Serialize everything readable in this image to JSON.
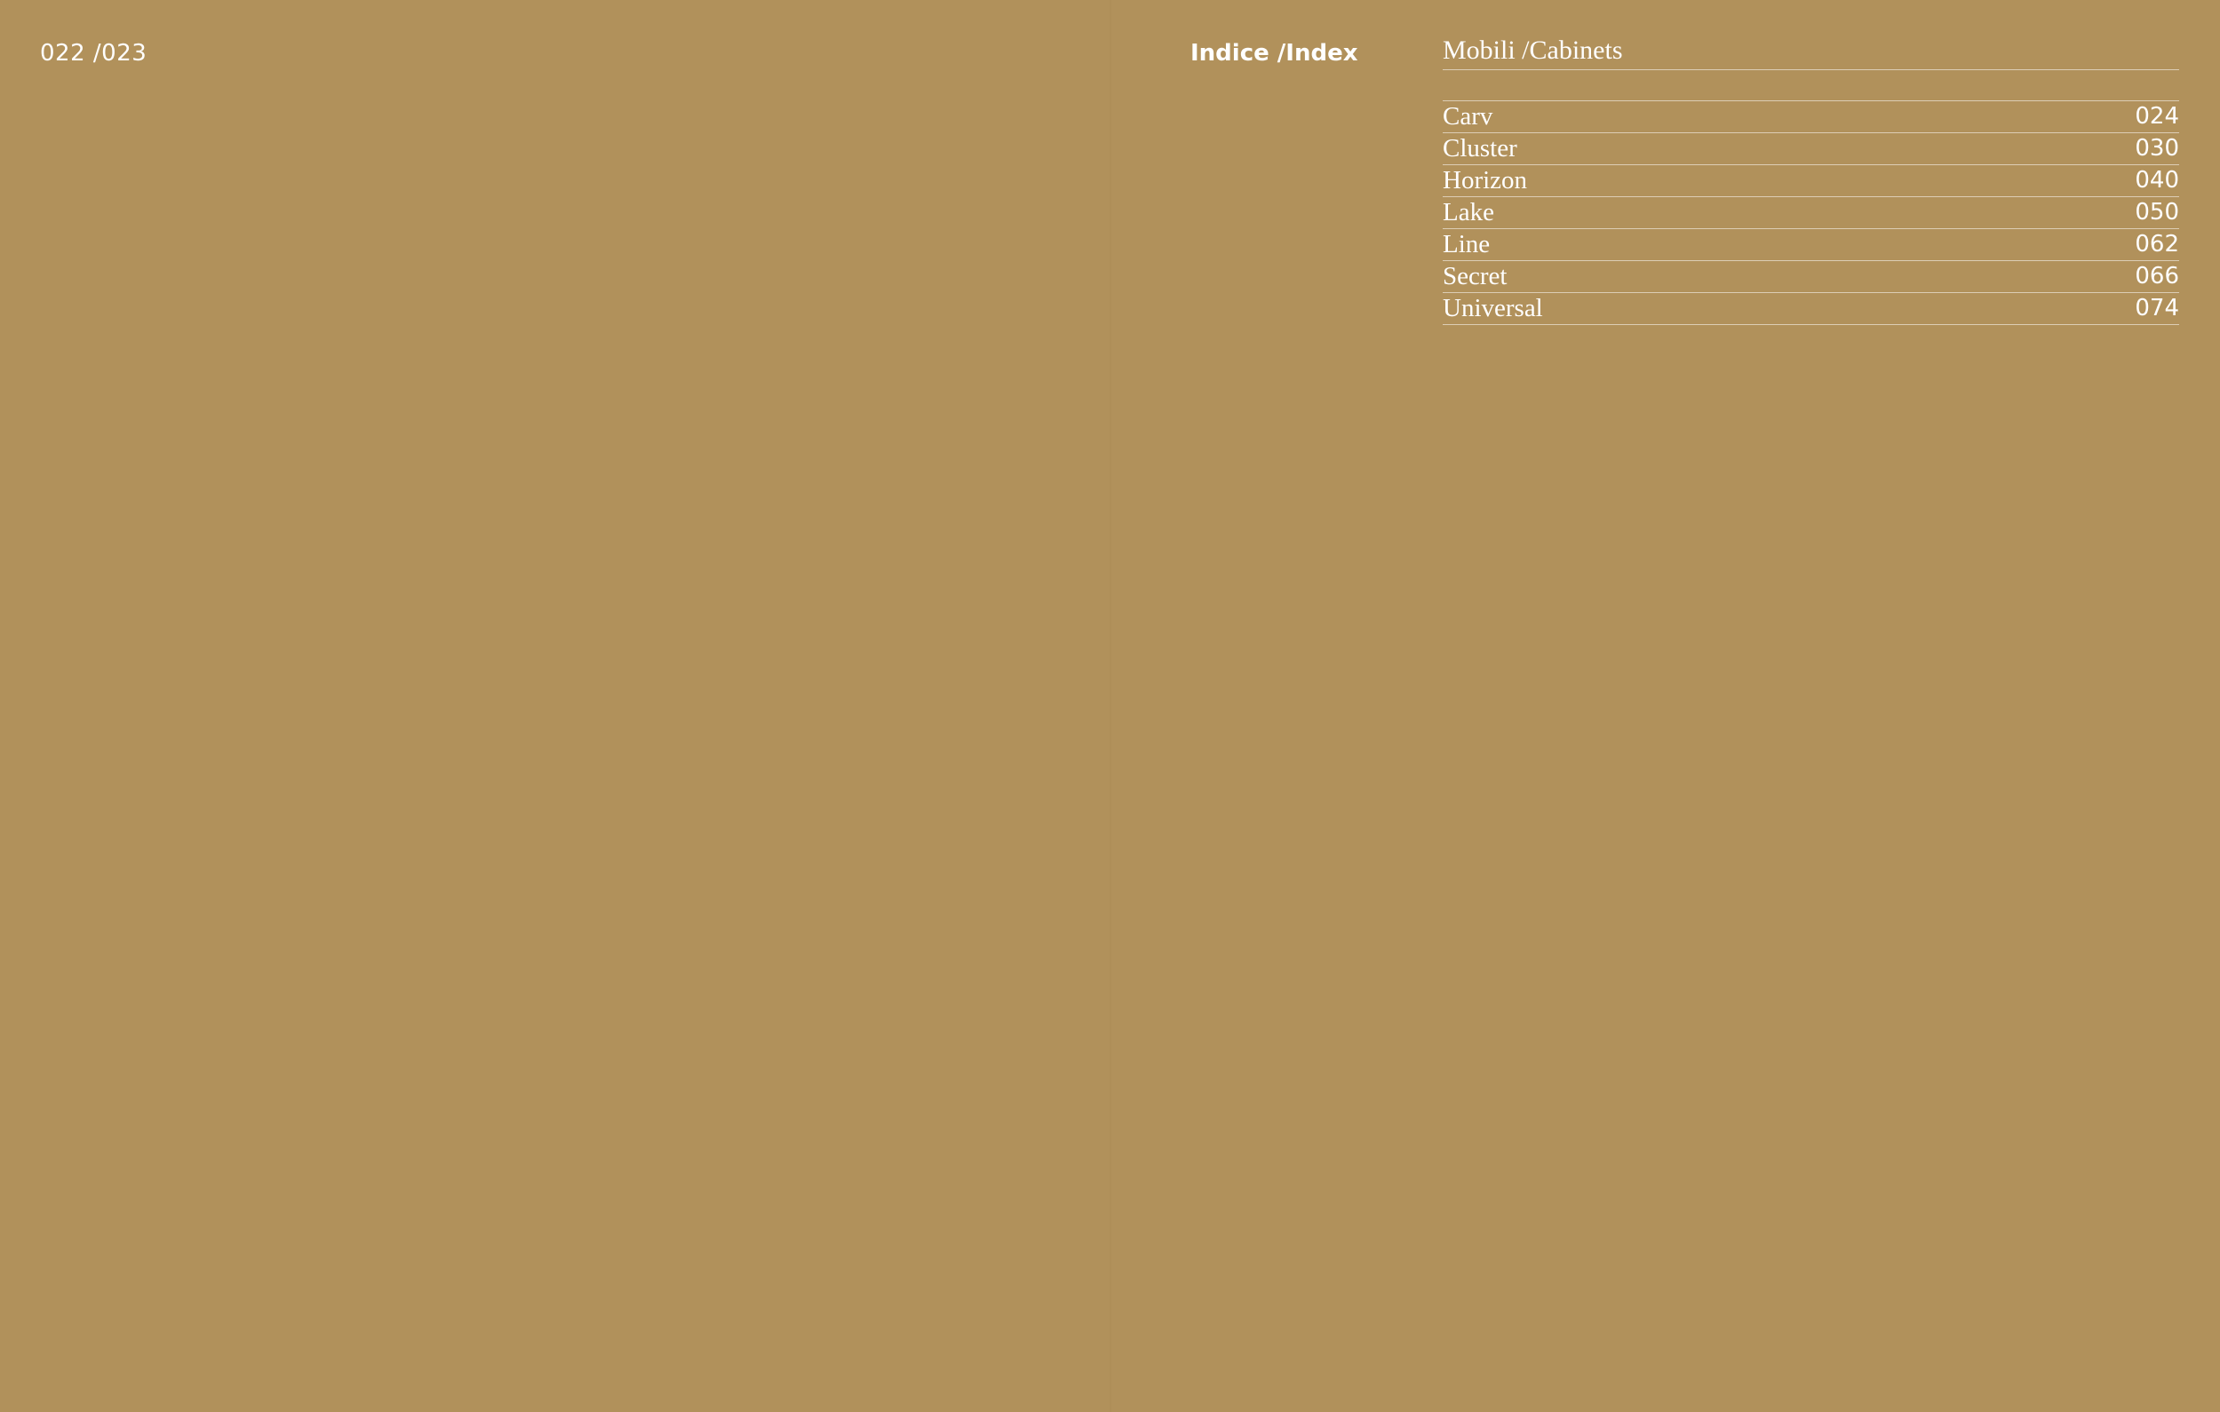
{
  "folio": {
    "page_numbers": "022 /023"
  },
  "index": {
    "title": "Indice /Index",
    "section_heading": "Mobili /Cabinets",
    "entries": [
      {
        "name": "Carv",
        "page": "024"
      },
      {
        "name": "Cluster",
        "page": "030"
      },
      {
        "name": "Horizon",
        "page": "040"
      },
      {
        "name": "Lake",
        "page": "050"
      },
      {
        "name": "Line",
        "page": "062"
      },
      {
        "name": "Secret",
        "page": "066"
      },
      {
        "name": "Universal",
        "page": "074"
      }
    ]
  },
  "colors": {
    "background": "#b1915b",
    "text": "#ffffff"
  }
}
